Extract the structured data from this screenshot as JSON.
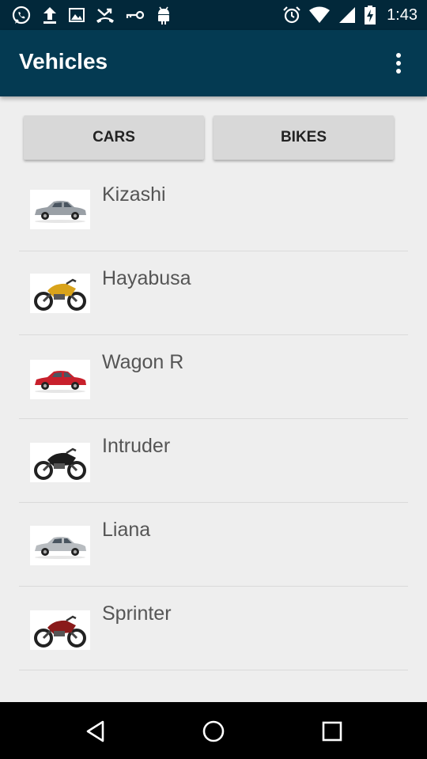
{
  "status_bar": {
    "time": "1:43",
    "left_icons": [
      "whatsapp-icon",
      "upload-icon",
      "image-icon",
      "missed-call-icon",
      "key-icon",
      "android-debug-icon"
    ],
    "right_icons": [
      "alarm-icon",
      "wifi-icon",
      "signal-icon",
      "battery-charging-icon"
    ]
  },
  "app_bar": {
    "title": "Vehicles",
    "overflow_icon": "more-vert-icon",
    "color": "#043a52"
  },
  "tabs": {
    "cars_label": "CARS",
    "bikes_label": "BIKES"
  },
  "vehicles": [
    {
      "name": "Kizashi",
      "kind": "car",
      "color": "#9aa0a6"
    },
    {
      "name": "Hayabusa",
      "kind": "bike",
      "color": "#d9a31a"
    },
    {
      "name": "Wagon R",
      "kind": "car",
      "color": "#c8202c"
    },
    {
      "name": "Intruder",
      "kind": "bike",
      "color": "#1c1c1c"
    },
    {
      "name": "Liana",
      "kind": "car",
      "color": "#b8bcc0"
    },
    {
      "name": "Sprinter",
      "kind": "bike",
      "color": "#8a1a1a"
    }
  ],
  "nav_bar": {
    "icons": [
      "back-icon",
      "home-icon",
      "recents-icon"
    ]
  }
}
